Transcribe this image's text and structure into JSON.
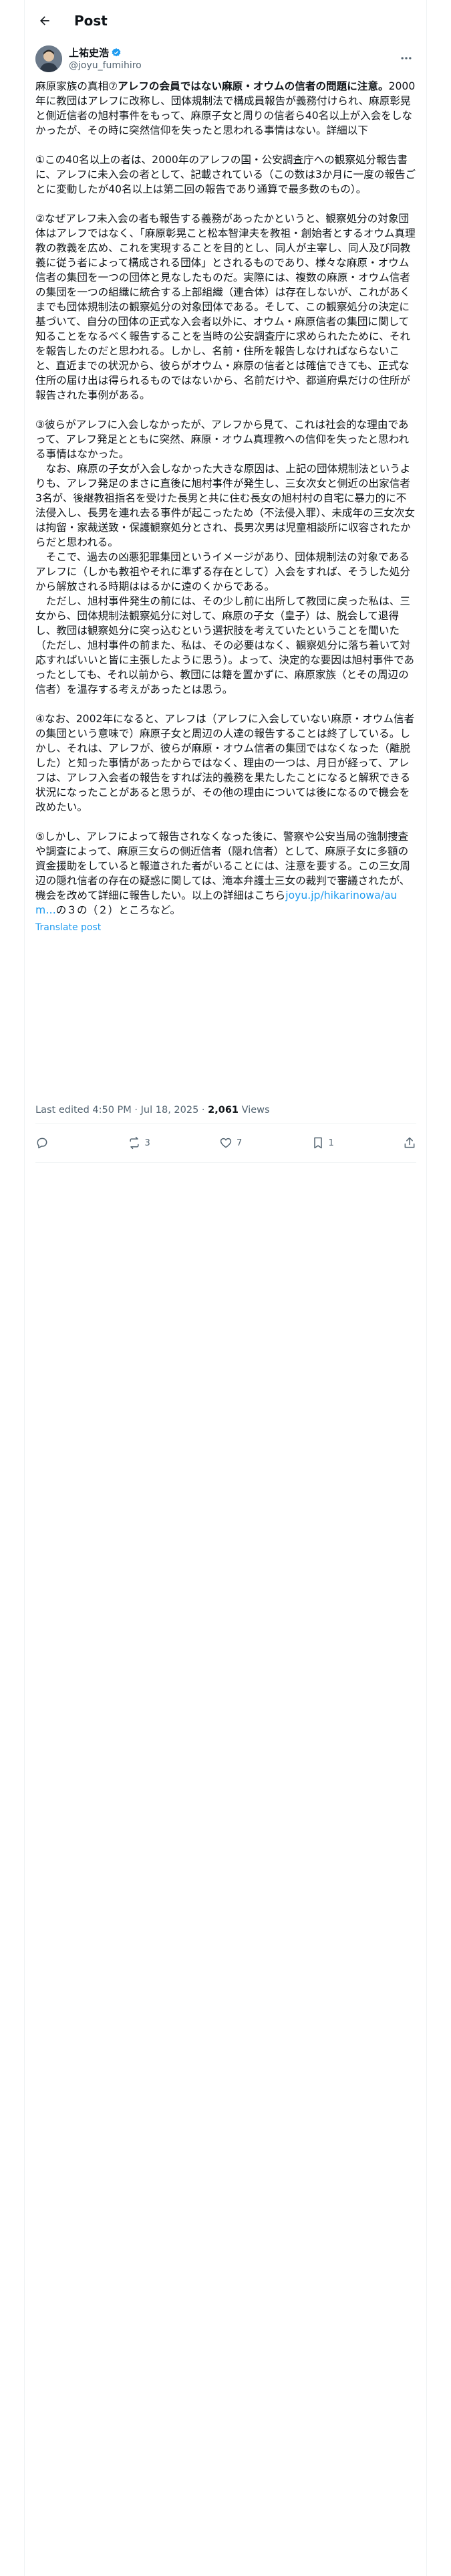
{
  "header": {
    "title": "Post"
  },
  "author": {
    "display_name": "上祐史浩",
    "handle": "@joyu_fumihiro"
  },
  "post": {
    "p1_lead": "麻原家族の真相⑦",
    "p1_strong": "アレフの会員ではない麻原・オウムの信者の問題に注意。",
    "p1_rest": "2000年に教団はアレフに改称し、団体規制法で構成員報告が義務付けられ、麻原彰晃と側近信者の旭村事件をもって、麻原子女と周りの信者ら40名以上が入会をしなかったが、その時に突然信仰を失ったと思われる事情はない。詳細以下",
    "p2": "①この40名以上の者は、2000年のアレフの国・公安調査庁への観察処分報告書に、アレフに未入会の者として、記載されている（この数は3か月に一度の報告ごとに変動したが40名以上は第二回の報告であり通算で最多数のもの）。",
    "p3": "②なぜアレフ未入会の者も報告する義務があったかというと、観察処分の対象団体はアレフではなく、「麻原彰晃こと松本智津夫を教祖・創始者とするオウム真理教の教義を広め、これを実現することを目的とし、同人が主宰し、同人及び同教義に従う者によって構成される団体」とされるものであり、様々な麻原・オウム信者の集団を一つの団体と見なしたものだ。実際には、複数の麻原・オウム信者の集団を一つの組織に統合する上部組織（連合体）は存在しないが、これがあくまでも団体規制法の観察処分の対象団体である。そして、この観察処分の決定に基づいて、自分の団体の正式な入会者以外に、オウム・麻原信者の集団に関して知ることをなるべく報告することを当時の公安調査庁に求められたために、それを報告したのだと思われる。しかし、名前・住所を報告しなければならないこと、直近までの状況から、彼らがオウム・麻原の信者とは確信できても、正式な住所の届け出は得られるものではないから、名前だけや、都道府県だけの住所が報告された事例がある。",
    "p4a": "③彼らがアレフに入会しなかったが、アレフから見て、これは社会的な理由であって、アレフ発足とともに突然、麻原・オウム真理教への信仰を失ったと思われる事情はなかった。",
    "p4b": "なお、麻原の子女が入会しなかった大きな原因は、上記の団体規制法というよりも、アレフ発足のまさに直後に旭村事件が発生し、三女次女と側近の出家信者3名が、後継教祖指名を受けた長男と共に住む長女の旭村村の自宅に暴力的に不法侵入し、長男を連れ去る事件が起こったため（不法侵入罪）、未成年の三女次女は拘留・家裁送致・保護観察処分とされ、長男次男は児童相談所に収容されたからだと思われる。",
    "p4c": "そこで、過去の凶悪犯罪集団というイメージがあり、団体規制法の対象であるアレフに（しかも教祖やそれに準ずる存在として）入会をすれば、そうした処分から解放される時期ははるかに遠のくからである。",
    "p4d": "ただし、旭村事件発生の前には、その少し前に出所して教団に戻った私は、三女から、団体規制法観察処分に対して、麻原の子女（皇子）は、脱会して退得し、教団は観察処分に突っ込むという選択肢を考えていたということを聞いた（ただし、旭村事件の前また、私は、その必要はなく、観察処分に落ち着いて対応すればいいと皆に主張したように思う）。よって、決定的な要因は旭村事件であったとしても、それ以前から、教団には籍を置かずに、麻原家族（とその周辺の信者）を温存する考えがあったとは思う。",
    "p5": "④なお、2002年になると、アレフは（アレフに入会していない麻原・オウム信者の集団という意味で）麻原子女と周辺の人達の報告することは終了している。しかし、それは、アレフが、彼らが麻原・オウム信者の集団ではなくなった（離脱した）と知った事情があったからではなく、理由の一つは、月日が経って、アレフは、アレフ入会者の報告をすれば法的義務を果たしたことになると解釈できる状況になったことがあると思うが、その他の理由については後になるので機会を改めたい。",
    "p6_text": "⑤しかし、アレフによって報告されなくなった後に、警察や公安当局の強制捜査や調査によって、麻原三女らの側近信者（隠れ信者）として、麻原子女に多額の資金援助をしていると報道された者がいることには、注意を要する。この三女周辺の隠れ信者の存在の疑惑に関しては、滝本弁護士三女の裁判で審議されたが、機会を改めて詳細に報告したい。以上の詳細はこちら",
    "p6_link": "joyu.jp/hikarinowa/aum…",
    "p6_tail": "の３の（２）ところなど。",
    "translate_label": "Translate post"
  },
  "meta": {
    "timestamp": "Last edited 4:50 PM · Jul 18, 2025",
    "sep": " · ",
    "views_count": "2,061",
    "views_label": " Views"
  },
  "actions": {
    "reply_count": "",
    "repost_count": "3",
    "like_count": "7",
    "bookmark_count": "1"
  },
  "colors": {
    "accent": "#1d9bf0",
    "text": "#0f1419",
    "muted": "#536471",
    "border": "#eff3f4"
  }
}
